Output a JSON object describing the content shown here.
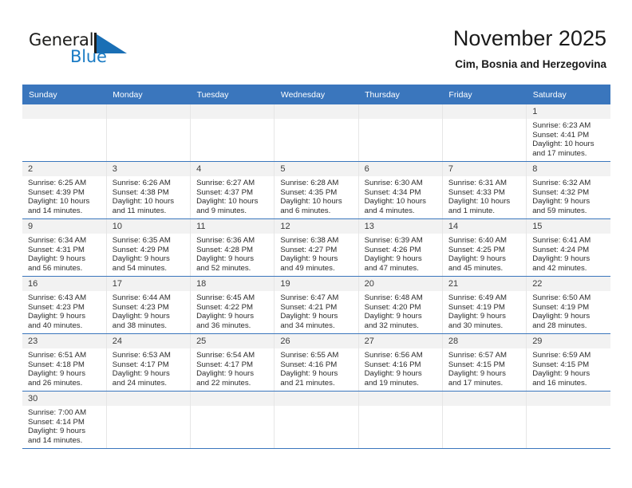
{
  "brand": {
    "name_top": "General",
    "name_bottom": "Blue",
    "flag_icon": "blue-flag-triangle",
    "color_dark": "#1d1d1b",
    "color_blue": "#1a7bc4"
  },
  "header": {
    "title": "November 2025",
    "subtitle": "Cim, Bosnia and Herzegovina"
  },
  "theme": {
    "header_bg": "#3a76bd",
    "daynum_bg": "#f2f2f2",
    "row_divider": "#3a76bd",
    "cell_divider": "#e6e6e6"
  },
  "weekdays": [
    "Sunday",
    "Monday",
    "Tuesday",
    "Wednesday",
    "Thursday",
    "Friday",
    "Saturday"
  ],
  "weeks": [
    [
      {
        "day": "",
        "blank": true,
        "sunrise": "",
        "sunset": "",
        "daylight1": "",
        "daylight2": ""
      },
      {
        "day": "",
        "blank": true,
        "sunrise": "",
        "sunset": "",
        "daylight1": "",
        "daylight2": ""
      },
      {
        "day": "",
        "blank": true,
        "sunrise": "",
        "sunset": "",
        "daylight1": "",
        "daylight2": ""
      },
      {
        "day": "",
        "blank": true,
        "sunrise": "",
        "sunset": "",
        "daylight1": "",
        "daylight2": ""
      },
      {
        "day": "",
        "blank": true,
        "sunrise": "",
        "sunset": "",
        "daylight1": "",
        "daylight2": ""
      },
      {
        "day": "",
        "blank": true,
        "sunrise": "",
        "sunset": "",
        "daylight1": "",
        "daylight2": ""
      },
      {
        "day": "1",
        "blank": false,
        "sunrise": "Sunrise: 6:23 AM",
        "sunset": "Sunset: 4:41 PM",
        "daylight1": "Daylight: 10 hours",
        "daylight2": "and 17 minutes."
      }
    ],
    [
      {
        "day": "2",
        "blank": false,
        "sunrise": "Sunrise: 6:25 AM",
        "sunset": "Sunset: 4:39 PM",
        "daylight1": "Daylight: 10 hours",
        "daylight2": "and 14 minutes."
      },
      {
        "day": "3",
        "blank": false,
        "sunrise": "Sunrise: 6:26 AM",
        "sunset": "Sunset: 4:38 PM",
        "daylight1": "Daylight: 10 hours",
        "daylight2": "and 11 minutes."
      },
      {
        "day": "4",
        "blank": false,
        "sunrise": "Sunrise: 6:27 AM",
        "sunset": "Sunset: 4:37 PM",
        "daylight1": "Daylight: 10 hours",
        "daylight2": "and 9 minutes."
      },
      {
        "day": "5",
        "blank": false,
        "sunrise": "Sunrise: 6:28 AM",
        "sunset": "Sunset: 4:35 PM",
        "daylight1": "Daylight: 10 hours",
        "daylight2": "and 6 minutes."
      },
      {
        "day": "6",
        "blank": false,
        "sunrise": "Sunrise: 6:30 AM",
        "sunset": "Sunset: 4:34 PM",
        "daylight1": "Daylight: 10 hours",
        "daylight2": "and 4 minutes."
      },
      {
        "day": "7",
        "blank": false,
        "sunrise": "Sunrise: 6:31 AM",
        "sunset": "Sunset: 4:33 PM",
        "daylight1": "Daylight: 10 hours",
        "daylight2": "and 1 minute."
      },
      {
        "day": "8",
        "blank": false,
        "sunrise": "Sunrise: 6:32 AM",
        "sunset": "Sunset: 4:32 PM",
        "daylight1": "Daylight: 9 hours",
        "daylight2": "and 59 minutes."
      }
    ],
    [
      {
        "day": "9",
        "blank": false,
        "sunrise": "Sunrise: 6:34 AM",
        "sunset": "Sunset: 4:31 PM",
        "daylight1": "Daylight: 9 hours",
        "daylight2": "and 56 minutes."
      },
      {
        "day": "10",
        "blank": false,
        "sunrise": "Sunrise: 6:35 AM",
        "sunset": "Sunset: 4:29 PM",
        "daylight1": "Daylight: 9 hours",
        "daylight2": "and 54 minutes."
      },
      {
        "day": "11",
        "blank": false,
        "sunrise": "Sunrise: 6:36 AM",
        "sunset": "Sunset: 4:28 PM",
        "daylight1": "Daylight: 9 hours",
        "daylight2": "and 52 minutes."
      },
      {
        "day": "12",
        "blank": false,
        "sunrise": "Sunrise: 6:38 AM",
        "sunset": "Sunset: 4:27 PM",
        "daylight1": "Daylight: 9 hours",
        "daylight2": "and 49 minutes."
      },
      {
        "day": "13",
        "blank": false,
        "sunrise": "Sunrise: 6:39 AM",
        "sunset": "Sunset: 4:26 PM",
        "daylight1": "Daylight: 9 hours",
        "daylight2": "and 47 minutes."
      },
      {
        "day": "14",
        "blank": false,
        "sunrise": "Sunrise: 6:40 AM",
        "sunset": "Sunset: 4:25 PM",
        "daylight1": "Daylight: 9 hours",
        "daylight2": "and 45 minutes."
      },
      {
        "day": "15",
        "blank": false,
        "sunrise": "Sunrise: 6:41 AM",
        "sunset": "Sunset: 4:24 PM",
        "daylight1": "Daylight: 9 hours",
        "daylight2": "and 42 minutes."
      }
    ],
    [
      {
        "day": "16",
        "blank": false,
        "sunrise": "Sunrise: 6:43 AM",
        "sunset": "Sunset: 4:23 PM",
        "daylight1": "Daylight: 9 hours",
        "daylight2": "and 40 minutes."
      },
      {
        "day": "17",
        "blank": false,
        "sunrise": "Sunrise: 6:44 AM",
        "sunset": "Sunset: 4:23 PM",
        "daylight1": "Daylight: 9 hours",
        "daylight2": "and 38 minutes."
      },
      {
        "day": "18",
        "blank": false,
        "sunrise": "Sunrise: 6:45 AM",
        "sunset": "Sunset: 4:22 PM",
        "daylight1": "Daylight: 9 hours",
        "daylight2": "and 36 minutes."
      },
      {
        "day": "19",
        "blank": false,
        "sunrise": "Sunrise: 6:47 AM",
        "sunset": "Sunset: 4:21 PM",
        "daylight1": "Daylight: 9 hours",
        "daylight2": "and 34 minutes."
      },
      {
        "day": "20",
        "blank": false,
        "sunrise": "Sunrise: 6:48 AM",
        "sunset": "Sunset: 4:20 PM",
        "daylight1": "Daylight: 9 hours",
        "daylight2": "and 32 minutes."
      },
      {
        "day": "21",
        "blank": false,
        "sunrise": "Sunrise: 6:49 AM",
        "sunset": "Sunset: 4:19 PM",
        "daylight1": "Daylight: 9 hours",
        "daylight2": "and 30 minutes."
      },
      {
        "day": "22",
        "blank": false,
        "sunrise": "Sunrise: 6:50 AM",
        "sunset": "Sunset: 4:19 PM",
        "daylight1": "Daylight: 9 hours",
        "daylight2": "and 28 minutes."
      }
    ],
    [
      {
        "day": "23",
        "blank": false,
        "sunrise": "Sunrise: 6:51 AM",
        "sunset": "Sunset: 4:18 PM",
        "daylight1": "Daylight: 9 hours",
        "daylight2": "and 26 minutes."
      },
      {
        "day": "24",
        "blank": false,
        "sunrise": "Sunrise: 6:53 AM",
        "sunset": "Sunset: 4:17 PM",
        "daylight1": "Daylight: 9 hours",
        "daylight2": "and 24 minutes."
      },
      {
        "day": "25",
        "blank": false,
        "sunrise": "Sunrise: 6:54 AM",
        "sunset": "Sunset: 4:17 PM",
        "daylight1": "Daylight: 9 hours",
        "daylight2": "and 22 minutes."
      },
      {
        "day": "26",
        "blank": false,
        "sunrise": "Sunrise: 6:55 AM",
        "sunset": "Sunset: 4:16 PM",
        "daylight1": "Daylight: 9 hours",
        "daylight2": "and 21 minutes."
      },
      {
        "day": "27",
        "blank": false,
        "sunrise": "Sunrise: 6:56 AM",
        "sunset": "Sunset: 4:16 PM",
        "daylight1": "Daylight: 9 hours",
        "daylight2": "and 19 minutes."
      },
      {
        "day": "28",
        "blank": false,
        "sunrise": "Sunrise: 6:57 AM",
        "sunset": "Sunset: 4:15 PM",
        "daylight1": "Daylight: 9 hours",
        "daylight2": "and 17 minutes."
      },
      {
        "day": "29",
        "blank": false,
        "sunrise": "Sunrise: 6:59 AM",
        "sunset": "Sunset: 4:15 PM",
        "daylight1": "Daylight: 9 hours",
        "daylight2": "and 16 minutes."
      }
    ],
    [
      {
        "day": "30",
        "blank": false,
        "sunrise": "Sunrise: 7:00 AM",
        "sunset": "Sunset: 4:14 PM",
        "daylight1": "Daylight: 9 hours",
        "daylight2": "and 14 minutes."
      },
      {
        "day": "",
        "blank": true,
        "sunrise": "",
        "sunset": "",
        "daylight1": "",
        "daylight2": ""
      },
      {
        "day": "",
        "blank": true,
        "sunrise": "",
        "sunset": "",
        "daylight1": "",
        "daylight2": ""
      },
      {
        "day": "",
        "blank": true,
        "sunrise": "",
        "sunset": "",
        "daylight1": "",
        "daylight2": ""
      },
      {
        "day": "",
        "blank": true,
        "sunrise": "",
        "sunset": "",
        "daylight1": "",
        "daylight2": ""
      },
      {
        "day": "",
        "blank": true,
        "sunrise": "",
        "sunset": "",
        "daylight1": "",
        "daylight2": ""
      },
      {
        "day": "",
        "blank": true,
        "sunrise": "",
        "sunset": "",
        "daylight1": "",
        "daylight2": ""
      }
    ]
  ]
}
